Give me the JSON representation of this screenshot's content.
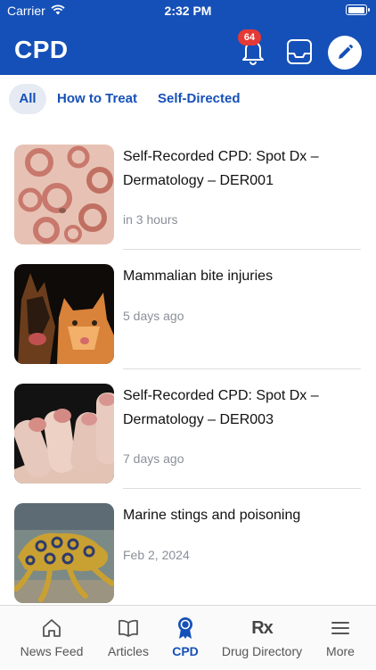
{
  "status_bar": {
    "carrier": "Carrier",
    "time": "2:32 PM",
    "battery_level": 1.0
  },
  "header": {
    "title": "CPD",
    "notification_count": "64"
  },
  "filters": [
    {
      "label": "All",
      "selected": true
    },
    {
      "label": "How to Treat",
      "selected": false
    },
    {
      "label": "Self-Directed",
      "selected": false
    }
  ],
  "items": [
    {
      "title": "Self-Recorded CPD: Spot Dx – Dermatology – DER001",
      "time": "in 3 hours",
      "image": "skin-rash-photo"
    },
    {
      "title": "Mammalian bite injuries",
      "time": "5 days ago",
      "image": "dog-and-cat-photo"
    },
    {
      "title": "Self-Recorded CPD: Spot Dx – Dermatology – DER003",
      "time": "7 days ago",
      "image": "fingers-photo"
    },
    {
      "title": "Marine stings and poisoning",
      "time": "Feb 2, 2024",
      "image": "octopus-photo"
    }
  ],
  "tabbar": {
    "news_feed": "News Feed",
    "articles": "Articles",
    "cpd": "CPD",
    "drug_directory": "Drug Directory",
    "drug_directory_icon_text": "Rx",
    "more": "More"
  },
  "colors": {
    "primary": "#1550b8",
    "badge": "#e53935",
    "muted_text": "#8a8f99"
  }
}
